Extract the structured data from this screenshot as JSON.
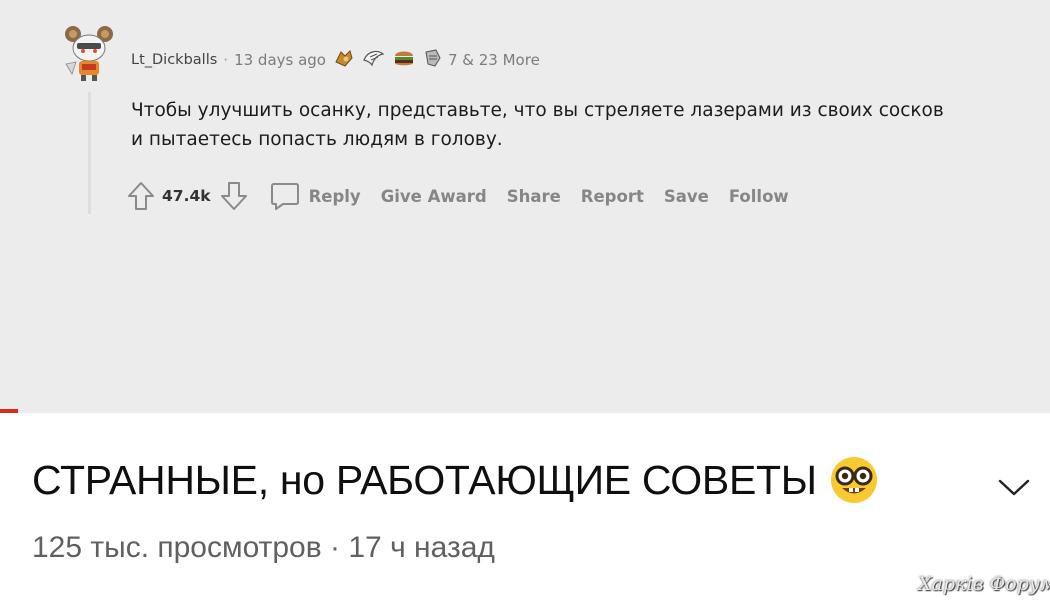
{
  "comment": {
    "username": "Lt_Dickballs",
    "separator": "·",
    "time_ago": "13 days ago",
    "awards_more": "7 & 23 More",
    "award_icons": [
      "hand-award-icon",
      "wing-award-icon",
      "burger-award-icon",
      "knight-award-icon"
    ],
    "text": "Чтобы улучшить осанку, представьте, что вы стреляете лазерами из своих сосков и пытаетесь попасть людям в голову.",
    "vote_count": "47.4k",
    "actions": {
      "reply": "Reply",
      "give_award": "Give Award",
      "share": "Share",
      "report": "Report",
      "save": "Save",
      "follow": "Follow"
    }
  },
  "video": {
    "title": "СТРАННЫЕ, но РАБОТАЮЩИЕ СОВЕТЫ",
    "title_emoji": "nerd-face-icon",
    "views": "125 тыс. просмотров",
    "separator": "·",
    "time_ago": "17 ч назад"
  },
  "watermark": "Харків Форум",
  "colors": {
    "comment_bg": "#ececec",
    "accent_red": "#d62b1f",
    "title_text": "#0f0f0f",
    "meta_text": "#606060"
  }
}
